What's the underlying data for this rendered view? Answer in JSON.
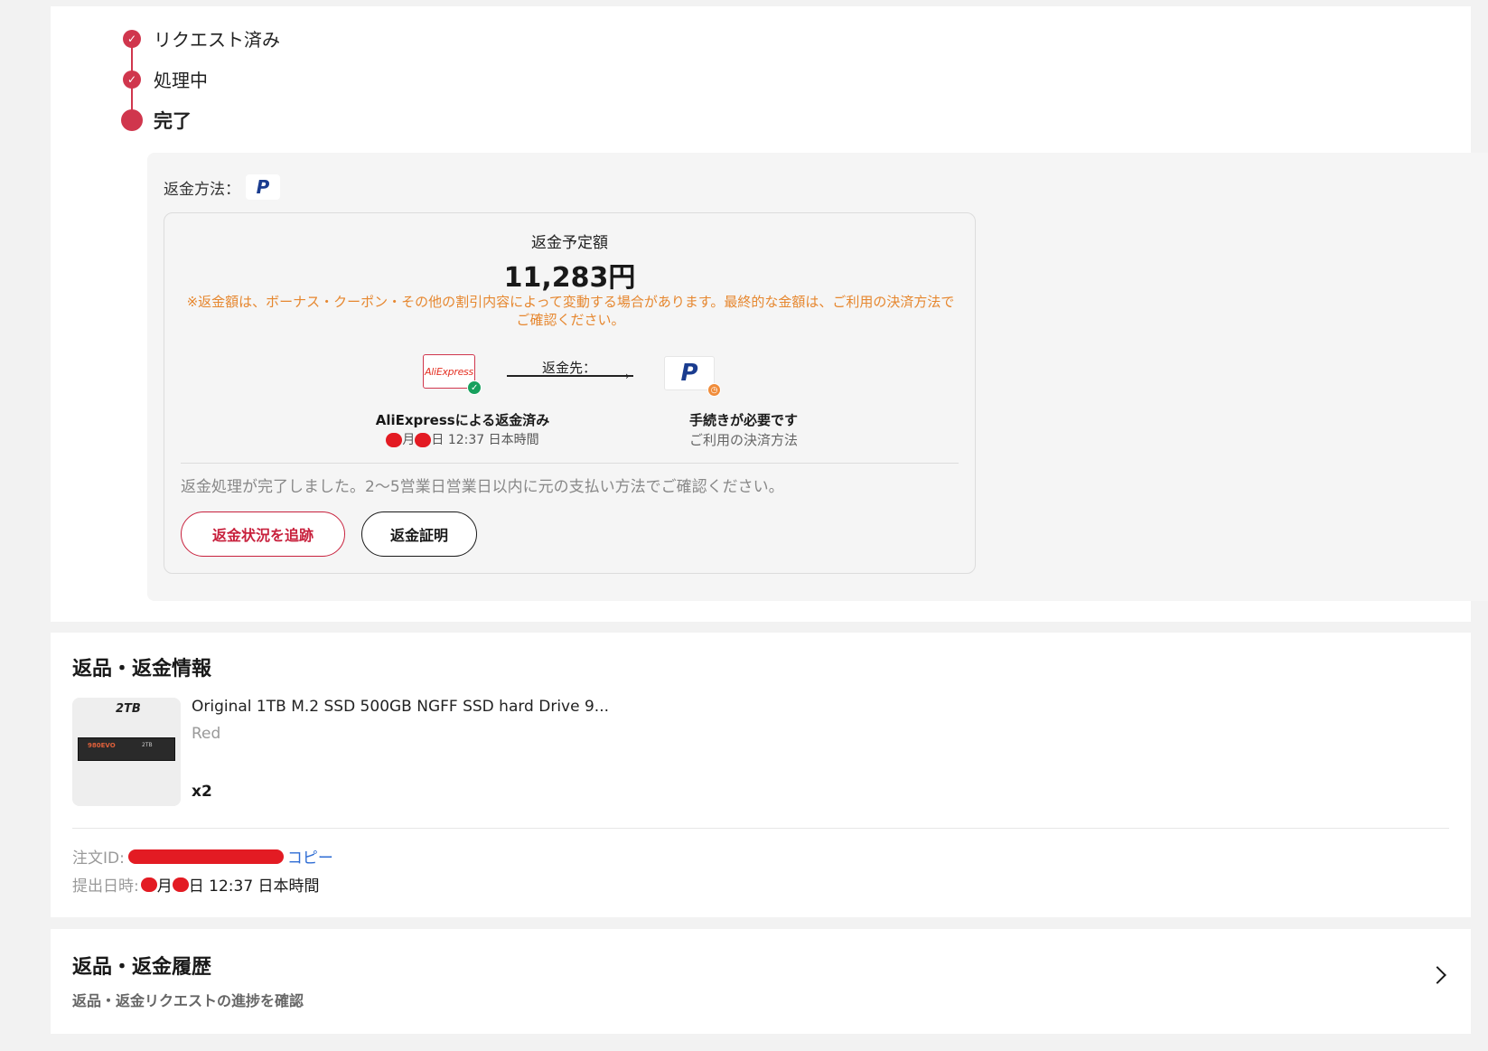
{
  "steps": [
    {
      "label": "リクエスト済み",
      "state": "done"
    },
    {
      "label": "処理中",
      "state": "done"
    },
    {
      "label": "完了",
      "state": "current"
    }
  ],
  "refund": {
    "method_label": "返金方法：",
    "method_icon": "paypal-icon",
    "expected_label": "返金予定額",
    "amount": "11,283円",
    "notice": "※返金額は、ボーナス・クーポン・その他の割引内容によって変動する場合があります。最終的な金額は、ご利用の決済方法でご確認ください。",
    "from_logo": "AliExpress",
    "arrow_label": "返金先：",
    "from_title": "AliExpressによる返金済み",
    "from_date_month_suffix": "月",
    "from_date_day_suffix": "日 12:37 日本時間",
    "to_title": "手続きが必要です",
    "to_sub": "ご利用の決済方法",
    "complete_message": "返金処理が完了しました。2〜5営業日営業日以内に元の支払い方法でご確認ください。",
    "track_button": "返金状況を追跡",
    "proof_button": "返金証明"
  },
  "info": {
    "title": "返品・返金情報",
    "product": {
      "thumb_label": "2TB",
      "ssd_label": "980EVO",
      "ssd_label2": "2TB",
      "name": "Original 1TB M.2 SSD 500GB NGFF SSD hard Drive 9...",
      "variant": "Red",
      "quantity": "x2"
    },
    "order_id_label": "注文ID:",
    "copy_label": "コピー",
    "submitted_label": "提出日時:",
    "submitted_month_suffix": "月",
    "submitted_day_suffix": "日 12:37 日本時間"
  },
  "history": {
    "title": "返品・返金履歴",
    "subtitle": "返品・返金リクエストの進捗を確認"
  },
  "colors": {
    "accent": "#d0364d",
    "notice": "#e6872f",
    "link": "#2e6cd4",
    "success": "#17a05d"
  }
}
